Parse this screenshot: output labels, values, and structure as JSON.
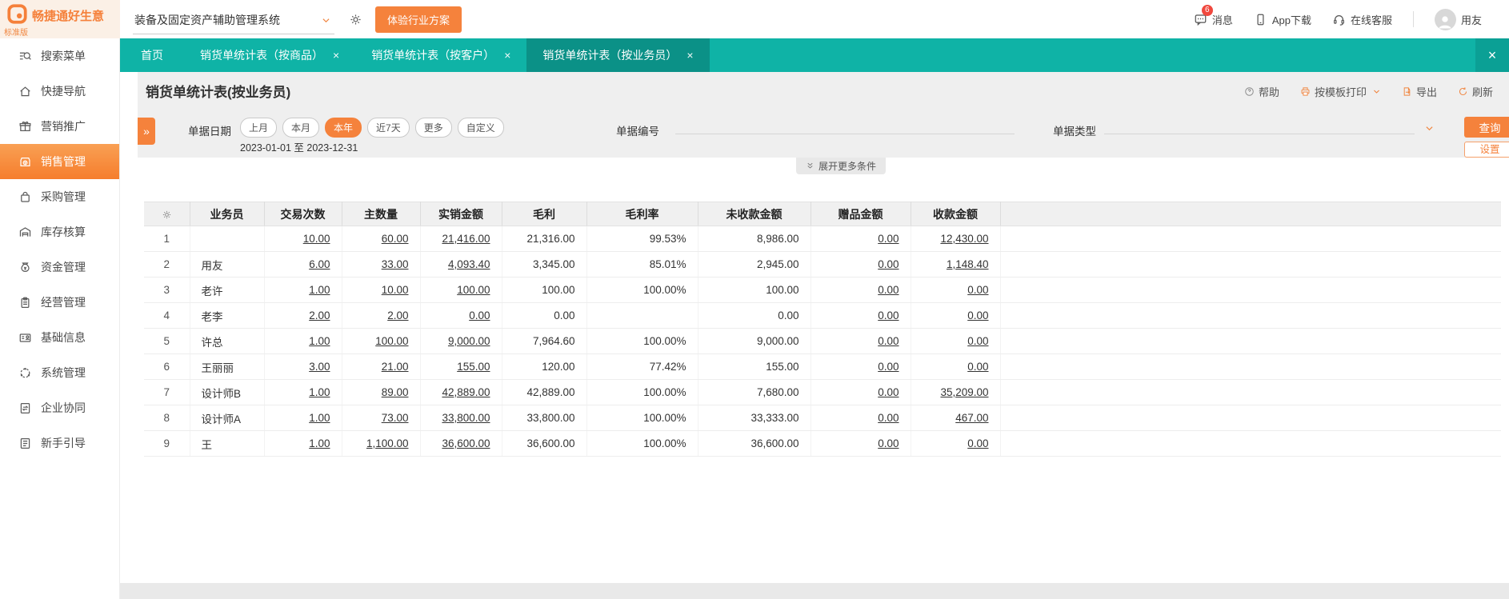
{
  "brand": {
    "name": "畅捷通好生意",
    "edition": "标准版"
  },
  "topbar": {
    "system_select": {
      "value": "装备及固定资产辅助管理系统",
      "icon": "chevron-down-icon"
    },
    "settings_icon": "gear-icon",
    "trial_button": "体验行业方案",
    "right_items": [
      {
        "name": "messages",
        "label": "消息",
        "icon": "message-icon",
        "badge": "6"
      },
      {
        "name": "app-download",
        "label": "App下载",
        "icon": "phone-icon",
        "badge": ""
      },
      {
        "name": "online-support",
        "label": "在线客服",
        "icon": "headset-icon",
        "badge": ""
      }
    ],
    "user": {
      "name": "用友",
      "icon": "avatar-icon"
    }
  },
  "tabs": [
    {
      "name": "home",
      "label": "首页",
      "closable": false,
      "active": false
    },
    {
      "name": "stats-by-product",
      "label": "销货单统计表（按商品）",
      "closable": true,
      "active": false
    },
    {
      "name": "stats-by-customer",
      "label": "销货单统计表（按客户）",
      "closable": true,
      "active": false
    },
    {
      "name": "stats-by-salesperson",
      "label": "销货单统计表（按业务员）",
      "closable": true,
      "active": true
    }
  ],
  "tabbar": {
    "close_all": "×"
  },
  "sidebar": {
    "items": [
      {
        "name": "search-menu",
        "label": "搜索菜单",
        "icon": "search-menu-icon",
        "active": false
      },
      {
        "name": "quick-nav",
        "label": "快捷导航",
        "icon": "home-icon",
        "active": false
      },
      {
        "name": "marketing-promo",
        "label": "营销推广",
        "icon": "gift-icon",
        "active": false
      },
      {
        "name": "sales-mgmt",
        "label": "销售管理",
        "icon": "sales-icon",
        "active": true
      },
      {
        "name": "purchase-mgmt",
        "label": "采购管理",
        "icon": "purchase-bag-icon",
        "active": false
      },
      {
        "name": "inventory-accounting",
        "label": "库存核算",
        "icon": "warehouse-icon",
        "active": false
      },
      {
        "name": "funds-mgmt",
        "label": "资金管理",
        "icon": "money-bag-icon",
        "active": false
      },
      {
        "name": "operations-mgmt",
        "label": "经营管理",
        "icon": "clipboard-icon",
        "active": false
      },
      {
        "name": "basic-info",
        "label": "基础信息",
        "icon": "id-card-icon",
        "active": false
      },
      {
        "name": "system-mgmt",
        "label": "系统管理",
        "icon": "system-icon",
        "active": false
      },
      {
        "name": "enterprise-collab",
        "label": "企业协同",
        "icon": "collab-icon",
        "active": false
      },
      {
        "name": "beginner-guide",
        "label": "新手引导",
        "icon": "guide-icon",
        "active": false
      }
    ]
  },
  "page": {
    "title": "销货单统计表(按业务员)"
  },
  "toolbar": {
    "items": [
      {
        "name": "help",
        "label": "帮助",
        "icon": "help-icon",
        "dropdown": false,
        "gray": true
      },
      {
        "name": "print-by-template",
        "label": "按模板打印",
        "icon": "printer-icon",
        "dropdown": true,
        "gray": false
      },
      {
        "name": "export",
        "label": "导出",
        "icon": "export-icon",
        "dropdown": false,
        "gray": false
      },
      {
        "name": "refresh",
        "label": "刷新",
        "icon": "refresh-icon",
        "dropdown": false,
        "gray": false
      }
    ]
  },
  "filters": {
    "date_label": "单据日期",
    "date_pills": [
      {
        "label": "上月",
        "active": false
      },
      {
        "label": "本月",
        "active": false
      },
      {
        "label": "本年",
        "active": true
      },
      {
        "label": "近7天",
        "active": false
      },
      {
        "label": "更多",
        "active": false
      },
      {
        "label": "自定义",
        "active": false
      }
    ],
    "date_range": "2023-01-01 至 2023-12-31",
    "bill_no_label": "单据编号",
    "bill_no_value": "",
    "bill_type_label": "单据类型",
    "bill_type_value": "",
    "expand_more": "展开更多条件",
    "search_button": "查询",
    "settings_button": "设置"
  },
  "table": {
    "columns": [
      "业务员",
      "交易次数",
      "主数量",
      "实销金额",
      "毛利",
      "毛利率",
      "未收款金额",
      "赠品金额",
      "收款金额"
    ],
    "link_columns": [
      1,
      2,
      3,
      7,
      8
    ],
    "rows": [
      [
        "",
        "10.00",
        "60.00",
        "21,416.00",
        "21,316.00",
        "99.53%",
        "8,986.00",
        "0.00",
        "12,430.00"
      ],
      [
        "用友",
        "6.00",
        "33.00",
        "4,093.40",
        "3,345.00",
        "85.01%",
        "2,945.00",
        "0.00",
        "1,148.40"
      ],
      [
        "老许",
        "1.00",
        "10.00",
        "100.00",
        "100.00",
        "100.00%",
        "100.00",
        "0.00",
        "0.00"
      ],
      [
        "老李",
        "2.00",
        "2.00",
        "0.00",
        "0.00",
        "",
        "0.00",
        "0.00",
        "0.00"
      ],
      [
        "许总",
        "1.00",
        "100.00",
        "9,000.00",
        "7,964.60",
        "100.00%",
        "9,000.00",
        "0.00",
        "0.00"
      ],
      [
        "王丽丽",
        "3.00",
        "21.00",
        "155.00",
        "120.00",
        "77.42%",
        "155.00",
        "0.00",
        "0.00"
      ],
      [
        "设计师B",
        "1.00",
        "89.00",
        "42,889.00",
        "42,889.00",
        "100.00%",
        "7,680.00",
        "0.00",
        "35,209.00"
      ],
      [
        "设计师A",
        "1.00",
        "73.00",
        "33,800.00",
        "33,800.00",
        "100.00%",
        "33,333.00",
        "0.00",
        "467.00"
      ],
      [
        "王",
        "1.00",
        "1,100.00",
        "36,600.00",
        "36,600.00",
        "100.00%",
        "36,600.00",
        "0.00",
        "0.00"
      ]
    ]
  }
}
